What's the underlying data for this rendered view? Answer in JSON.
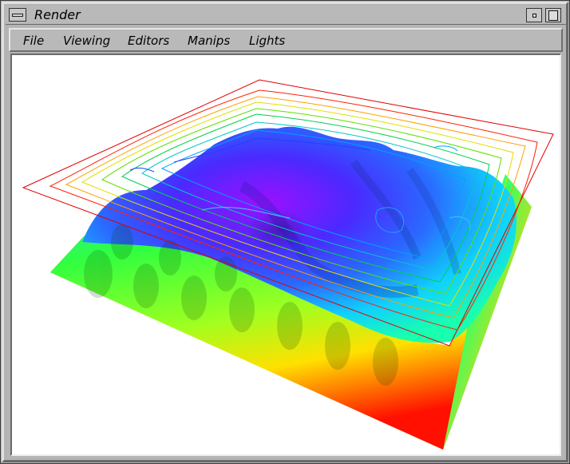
{
  "window": {
    "title": "Render"
  },
  "menubar": {
    "items": [
      {
        "label": "File"
      },
      {
        "label": "Viewing"
      },
      {
        "label": "Editors"
      },
      {
        "label": "Manips"
      },
      {
        "label": "Lights"
      }
    ]
  },
  "scene": {
    "description_colors": {
      "base_edge": "#ff0000",
      "low": "#ffff00",
      "mid_low": "#00ff00",
      "mid": "#00ffff",
      "mid_high": "#2060ff",
      "high": "#a000ff",
      "contour_plane_border": "#e00000"
    },
    "icons": {
      "window_menu": "window-menu-icon",
      "minimize": "minimize-icon",
      "maximize": "maximize-icon"
    }
  }
}
